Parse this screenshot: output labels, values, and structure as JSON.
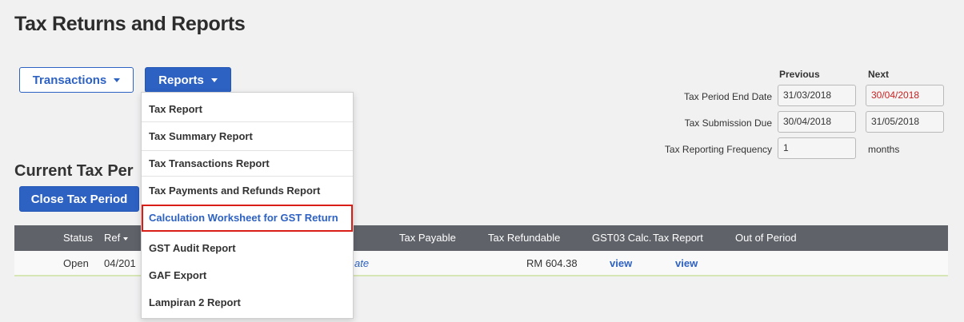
{
  "page": {
    "title": "Tax Returns and Reports"
  },
  "toolbar": {
    "transactions_label": "Transactions",
    "reports_label": "Reports"
  },
  "reports_menu": {
    "items": [
      "Tax Report",
      "Tax Summary Report",
      "Tax Transactions Report",
      "Tax Payments and Refunds Report",
      "Calculation Worksheet for GST Return",
      "GST Audit Report",
      "GAF Export",
      "Lampiran 2 Report"
    ],
    "highlighted": "Calculation Worksheet for GST Return"
  },
  "current_period": {
    "title": "Current Tax Per",
    "close_label": "Close Tax Period"
  },
  "grid": {
    "headers": {
      "status": "Status",
      "ref": "Ref",
      "tax_payable": "Tax Payable",
      "tax_refundable": "Tax Refundable",
      "gst03": "GST03 Calc.",
      "tax_report": "Tax Report",
      "out_of_period": "Out of Period"
    },
    "rows": [
      {
        "status": "Open",
        "ref": "04/201",
        "link": "ate",
        "tax_refundable": "RM 604.38",
        "gst03": "view",
        "tax_report": "view"
      }
    ]
  },
  "period_panel": {
    "previous_label": "Previous",
    "next_label": "Next",
    "end_date_label": "Tax Period End Date",
    "prev_end_date": "31/03/2018",
    "next_end_date": "30/04/2018",
    "submission_label": "Tax Submission Due",
    "prev_submission": "30/04/2018",
    "next_submission": "31/05/2018",
    "frequency_label": "Tax Reporting Frequency",
    "frequency_value": "1",
    "frequency_unit": "months"
  },
  "colors": {
    "primary": "#2d61c2",
    "header_bg": "#5f6269",
    "highlight_border": "#d91e18",
    "warning_text": "#c82323"
  }
}
